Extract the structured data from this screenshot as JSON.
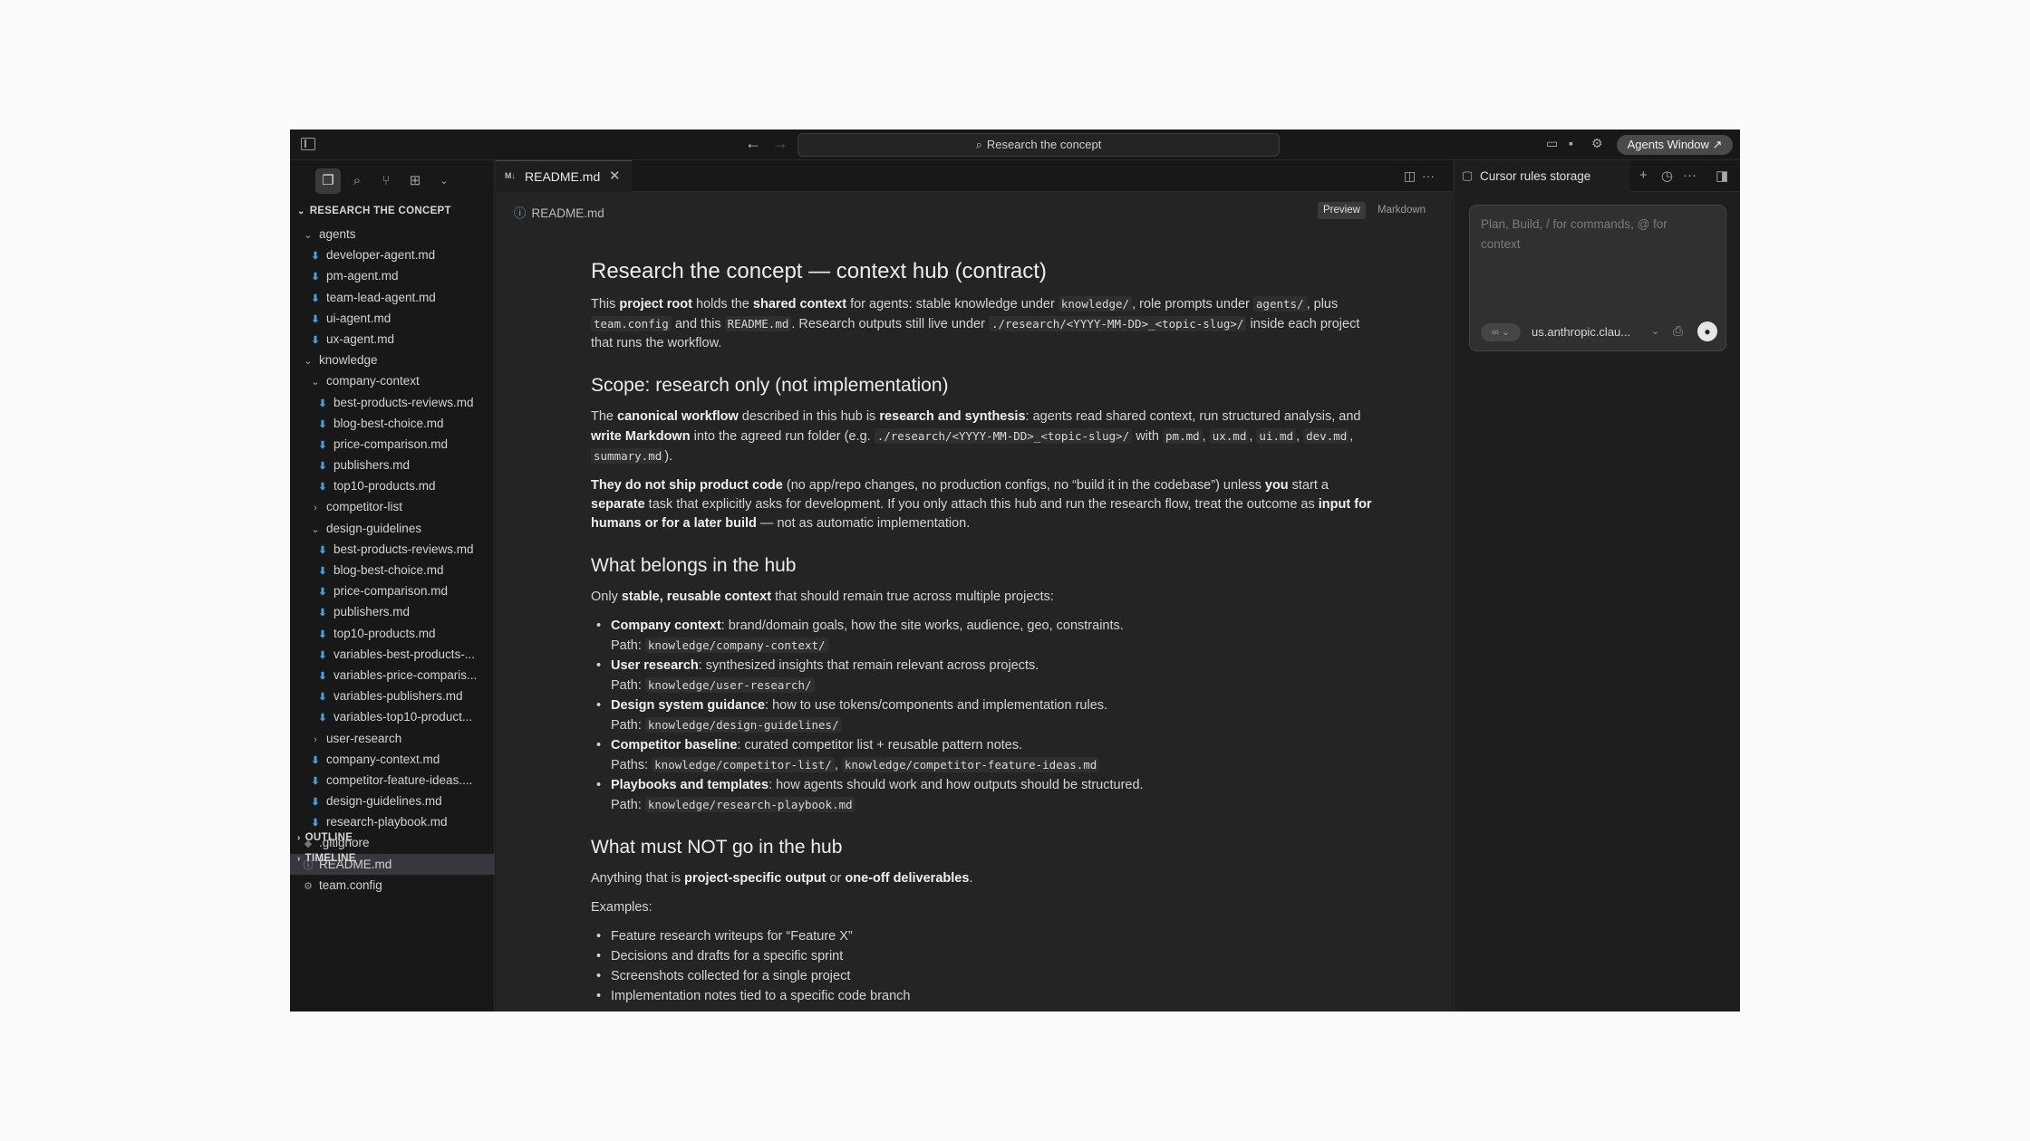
{
  "titlebar": {
    "search_text": "Research the concept",
    "agents_button": "Agents Window ↗"
  },
  "sidebar": {
    "section_title": "RESEARCH THE CONCEPT",
    "outline_label": "OUTLINE",
    "timeline_label": "TIMELINE",
    "tree": [
      {
        "label": "agents",
        "icon": "chevron-down",
        "depth": 1
      },
      {
        "label": "developer-agent.md",
        "icon": "markdown",
        "depth": 2
      },
      {
        "label": "pm-agent.md",
        "icon": "markdown",
        "depth": 2
      },
      {
        "label": "team-lead-agent.md",
        "icon": "markdown",
        "depth": 2
      },
      {
        "label": "ui-agent.md",
        "icon": "markdown",
        "depth": 2
      },
      {
        "label": "ux-agent.md",
        "icon": "markdown",
        "depth": 2
      },
      {
        "label": "knowledge",
        "icon": "chevron-down",
        "depth": 1
      },
      {
        "label": "company-context",
        "icon": "chevron-down",
        "depth": 2
      },
      {
        "label": "best-products-reviews.md",
        "icon": "markdown",
        "depth": 3
      },
      {
        "label": "blog-best-choice.md",
        "icon": "markdown",
        "depth": 3
      },
      {
        "label": "price-comparison.md",
        "icon": "markdown",
        "depth": 3
      },
      {
        "label": "publishers.md",
        "icon": "markdown",
        "depth": 3
      },
      {
        "label": "top10-products.md",
        "icon": "markdown",
        "depth": 3
      },
      {
        "label": "competitor-list",
        "icon": "chevron-right",
        "depth": 2
      },
      {
        "label": "design-guidelines",
        "icon": "chevron-down",
        "depth": 2
      },
      {
        "label": "best-products-reviews.md",
        "icon": "markdown",
        "depth": 3
      },
      {
        "label": "blog-best-choice.md",
        "icon": "markdown",
        "depth": 3
      },
      {
        "label": "price-comparison.md",
        "icon": "markdown",
        "depth": 3
      },
      {
        "label": "publishers.md",
        "icon": "markdown",
        "depth": 3
      },
      {
        "label": "top10-products.md",
        "icon": "markdown",
        "depth": 3
      },
      {
        "label": "variables-best-products-...",
        "icon": "markdown",
        "depth": 3
      },
      {
        "label": "variables-price-comparis...",
        "icon": "markdown",
        "depth": 3
      },
      {
        "label": "variables-publishers.md",
        "icon": "markdown",
        "depth": 3
      },
      {
        "label": "variables-top10-product...",
        "icon": "markdown",
        "depth": 3
      },
      {
        "label": "user-research",
        "icon": "chevron-right",
        "depth": 2
      },
      {
        "label": "company-context.md",
        "icon": "markdown",
        "depth": 2
      },
      {
        "label": "competitor-feature-ideas....",
        "icon": "markdown",
        "depth": 2
      },
      {
        "label": "design-guidelines.md",
        "icon": "markdown",
        "depth": 2
      },
      {
        "label": "research-playbook.md",
        "icon": "markdown",
        "depth": 2
      },
      {
        "label": ".gitignore",
        "icon": "git",
        "depth": 1
      },
      {
        "label": "README.md",
        "icon": "info",
        "depth": 1,
        "selected": true
      },
      {
        "label": "team.config",
        "icon": "gear",
        "depth": 1
      }
    ]
  },
  "editor": {
    "tab_label": "README.md",
    "tab_badge": "M↓",
    "breadcrumb": "README.md",
    "preview_label": "Preview",
    "markdown_label": "Markdown"
  },
  "doc": {
    "h1": "Research the concept — context hub (contract)",
    "p1": {
      "a": "This ",
      "b1": "project root",
      "c": " holds the ",
      "b2": "shared context",
      "d": " for agents: stable knowledge under ",
      "code1": "knowledge/",
      "e": ", role prompts under ",
      "code2": "agents/",
      "f": ", plus ",
      "code3": "team.config",
      "g": " and this ",
      "code4": "README.md",
      "h": ". Research outputs still live under ",
      "code5": "./research/<YYYY-MM-DD>_<topic-slug>/",
      "i": " inside each project that runs the workflow."
    },
    "h2a": "Scope: research only (not implementation)",
    "p2": {
      "a": "The ",
      "b1": "canonical workflow",
      "c": " described in this hub is ",
      "b2": "research and synthesis",
      "d": ": agents read shared context, run structured analysis, and ",
      "b3": "write Markdown",
      "e": " into the agreed run folder (e.g. ",
      "code1": "./research/<YYYY-MM-DD>_<topic-slug>/",
      "f": " with ",
      "code2": "pm.md",
      "g": ", ",
      "code3": "ux.md",
      "h": ", ",
      "code4": "ui.md",
      "i": ", ",
      "code5": "dev.md",
      "j": ", ",
      "code6": "summary.md",
      "k": ")."
    },
    "p3": {
      "b1": "They do not ship product code",
      "a": " (no app/repo changes, no production configs, no “build it in the codebase”) unless ",
      "b2": "you",
      "c": " start a ",
      "b3": "separate",
      "d": " task that explicitly asks for development. If you only attach this hub and run the research flow, treat the outcome as ",
      "b4": "input for humans or for a later build",
      "e": " — not as automatic implementation."
    },
    "h2b": "What belongs in the hub",
    "p4": {
      "a": "Only ",
      "b1": "stable, reusable context",
      "c": " that should remain true across multiple projects:"
    },
    "belongs": [
      {
        "title": "Company context",
        "desc": ": brand/domain goals, how the site works, audience, geo, constraints.",
        "path_label": "Path: ",
        "paths": [
          "knowledge/company-context/"
        ]
      },
      {
        "title": "User research",
        "desc": ": synthesized insights that remain relevant across projects.",
        "path_label": "Path: ",
        "paths": [
          "knowledge/user-research/"
        ]
      },
      {
        "title": "Design system guidance",
        "desc": ": how to use tokens/components and implementation rules.",
        "path_label": "Path: ",
        "paths": [
          "knowledge/design-guidelines/"
        ]
      },
      {
        "title": "Competitor baseline",
        "desc": ": curated competitor list + reusable pattern notes.",
        "path_label": "Paths: ",
        "paths": [
          "knowledge/competitor-list/",
          "knowledge/competitor-feature-ideas.md"
        ]
      },
      {
        "title": "Playbooks and templates",
        "desc": ": how agents should work and how outputs should be structured.",
        "path_label": "Path: ",
        "paths": [
          "knowledge/research-playbook.md"
        ]
      }
    ],
    "h2c": "What must NOT go in the hub",
    "p5": {
      "a": "Anything that is ",
      "b1": "project-specific output",
      "c": " or ",
      "b2": "one-off deliverables",
      "d": "."
    },
    "p6": "Examples:",
    "examples": [
      "Feature research writeups for “Feature X”",
      "Decisions and drafts for a specific sprint",
      "Screenshots collected for a single project",
      "Implementation notes tied to a specific code branch"
    ]
  },
  "agent": {
    "tab_label": "Cursor rules storage",
    "placeholder": "Plan, Build, / for commands, @ for context",
    "mode_label": "∞ ⌄",
    "model": "us.anthropic.clau...",
    "model_chevron": "⌄"
  }
}
